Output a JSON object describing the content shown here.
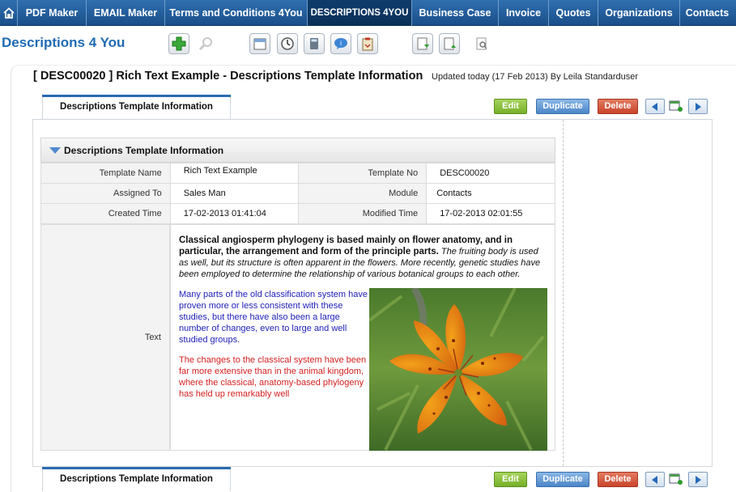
{
  "nav": {
    "home_icon": "home-icon",
    "tabs": [
      {
        "label": "PDF Maker",
        "active": false
      },
      {
        "label": "EMAIL Maker",
        "active": false
      },
      {
        "label": "Terms and Conditions 4You",
        "active": false
      },
      {
        "label": "DESCRIPTIONS 4YOU",
        "active": true
      },
      {
        "label": "Business Case",
        "active": false
      },
      {
        "label": "Invoice",
        "active": false
      },
      {
        "label": "Quotes",
        "active": false
      },
      {
        "label": "Organizations",
        "active": false
      },
      {
        "label": "Contacts",
        "active": false
      }
    ]
  },
  "module": {
    "title": "Descriptions 4 You"
  },
  "toolbar": {
    "icons": [
      "add-icon",
      "search-icon",
      "calendar-icon",
      "clock-icon",
      "calculator-icon",
      "chat-icon",
      "clipboard-icon",
      "import-icon",
      "export-icon",
      "find-duplicates-icon"
    ]
  },
  "record": {
    "title": "[ DESC00020 ] Rich Text Example - Descriptions Template Information",
    "updated": "Updated today (17 Feb 2013) By Leila Standarduser"
  },
  "tabs": {
    "info_label": "Descriptions Template Information"
  },
  "actions": {
    "edit": "Edit",
    "duplicate": "Duplicate",
    "delete": "Delete"
  },
  "block": {
    "title": "Descriptions Template Information"
  },
  "fields": {
    "template_name_label": "Template Name",
    "template_name": "Rich Text Example",
    "template_no_label": "Template No",
    "template_no": "DESC00020",
    "assigned_to_label": "Assigned To",
    "assigned_to": "Sales Man",
    "module_label": "Module",
    "module": "Contacts",
    "created_label": "Created Time",
    "created": "17-02-2013 01:41:04",
    "modified_label": "Modified Time",
    "modified": "17-02-2013 02:01:55",
    "text_label": "Text"
  },
  "text": {
    "p1_bold": "Classical angiosperm phylogeny is based mainly on flower anatomy, and in particular, the arrangement and form of the principle parts.",
    "p1_italic": " The fruiting body is used as well, but its structure is often apparent in the flowers. More recently, genetic studies have been employed to determine the relationship of various botanical groups to each other.",
    "p2": "Many parts of the old classification system have proven more or less consistent with these studies, but there have also been a large number of changes, even to large and well studied groups.",
    "p3": "The changes to the classical system have been far more extensive than in the animal kingdom, where the classical, anatomy-based phylogeny has held up remarkably well",
    "image_name": "orange-lily-photo"
  },
  "colors": {
    "nav": "#1f5c9c",
    "title_blue": "#1f6bb3",
    "edit": "#7ab630",
    "duplicate": "#4f88c9",
    "delete": "#cc4a2f",
    "para_blue": "#2121b8",
    "para_red": "#d42020"
  }
}
